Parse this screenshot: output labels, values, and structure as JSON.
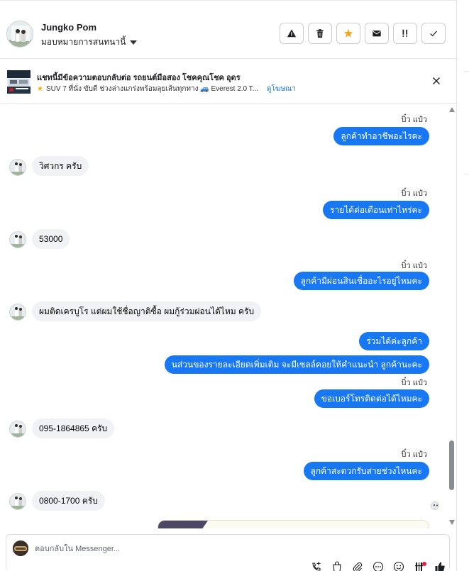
{
  "header": {
    "contact_name": "Jungko Pom",
    "assign_label": "มอบหมายการสนทนานี้",
    "actions": [
      {
        "name": "mark-spam-button",
        "icon": "warning-icon"
      },
      {
        "name": "delete-button",
        "icon": "trash-icon"
      },
      {
        "name": "star-button",
        "icon": "star-icon"
      },
      {
        "name": "mark-unread-button",
        "icon": "envelope-icon"
      },
      {
        "name": "follow-up-button",
        "icon": "flag-exclaim-icon"
      },
      {
        "name": "mark-done-button",
        "icon": "check-icon"
      }
    ],
    "accent_star": "#f5a623"
  },
  "ad_banner": {
    "title": "แชทนี้มีข้อความตอบกลับต่อ รถยนต์มือสอง โชคคุณโชค อุดร",
    "description": "SUV 7 ที่นั่ง ขับดี ช่วงล่างแกร่งพร้อมลุยเส้นทุกทาง 🚙 Everest 2.0 T...",
    "link_label": "ดูโฆษณา"
  },
  "thread": {
    "messages": [
      {
        "direction": "out",
        "sender": "บิ๋ว แป๋ว",
        "text": "ลูกค้าทำอาชีพอะไรคะ"
      },
      {
        "direction": "in",
        "text": "วิศวกร ครับ"
      },
      {
        "direction": "out",
        "sender": "บิ๋ว แป๋ว",
        "text": "รายได้ต่อเดือนเท่าไหร่คะ"
      },
      {
        "direction": "in",
        "text": "53000"
      },
      {
        "direction": "out",
        "sender": "บิ๋ว แป๋ว",
        "text": "ลูกค้ามีผ่อนสินเชื่ออะไรอยู่ไหมคะ"
      },
      {
        "direction": "in",
        "text": "ผมติดเครบูโร แต่ผมใช้ชื่อญาติซื้อ ผมกู้ร่วมผ่อนได้ไหม ครับ"
      },
      {
        "direction": "out",
        "text": "ร่วมได้ค่ะลูกค้า"
      },
      {
        "direction": "out",
        "text": "นส่วนของรายละเอียดเพิ่มเติม จะมีเซลล์คอยให้คำแนะนำ ลูกค้านะคะ"
      },
      {
        "direction": "out",
        "sender": "บิ๋ว แป๋ว",
        "text": "ขอเบอร์โทรติดต่อได้ไหมคะ"
      },
      {
        "direction": "in",
        "text": "095-1864865 ครับ"
      },
      {
        "direction": "out",
        "sender": "บิ๋ว แป๋ว",
        "text": "ลูกค้าสะดวกรับสายช่วงไหนคะ"
      },
      {
        "direction": "in",
        "text": "0800-1700 ครับ"
      }
    ],
    "bubble_color": "#1877f2"
  },
  "composer": {
    "placeholder": "ตอบกลับใน Messenger...",
    "tools": [
      "add-contact-icon",
      "shopping-bag-icon",
      "attachment-icon",
      "more-icon",
      "emoji-icon",
      "saved-replies-icon",
      "thumbs-up-icon"
    ]
  }
}
